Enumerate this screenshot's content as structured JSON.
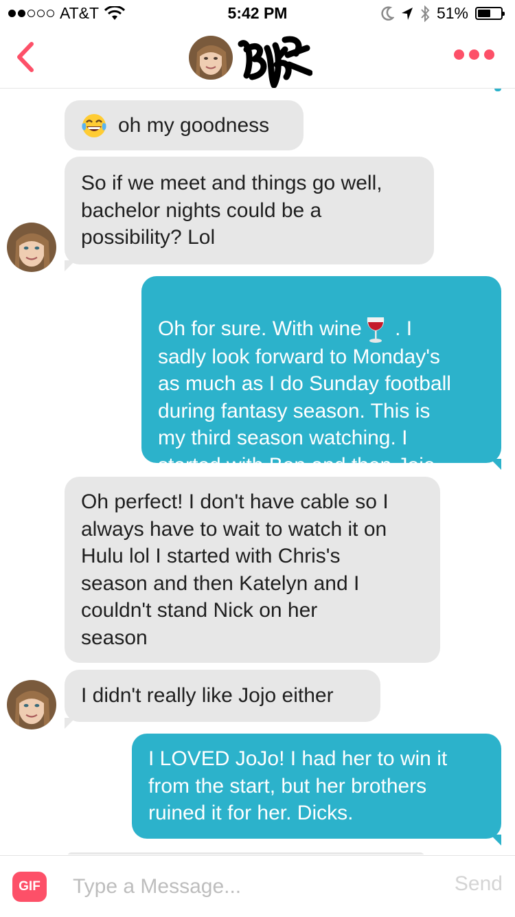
{
  "status_bar": {
    "carrier": "AT&T",
    "time": "5:42 PM",
    "battery": "51%",
    "signal_bars_filled": 2,
    "signal_bars_total": 5,
    "battery_level": 0.51
  },
  "nav": {
    "back_icon": "chevron-left-icon",
    "more_icon": "more-dots-icon",
    "accent_color": "#fd5068"
  },
  "messages": [
    {
      "from": "them",
      "emoji": "tears-of-joy",
      "text": "oh my goodness"
    },
    {
      "from": "them",
      "text": "So if we meet and things go well,\nbachelor nights could be a\npossibility? Lol"
    },
    {
      "from": "me",
      "text_before_emoji": "Oh for sure.  With wine",
      "emoji": "wine-glass",
      "text_after_emoji": " .  I\nsadly look forward to Monday's\nas much as I do Sunday football\nduring fantasy season.  This is\nmy third season watching.  I\nstarted with Ben and then Jojo."
    },
    {
      "from": "them",
      "text": "Oh perfect! I don't have cable so I\nalways have to wait to watch it on\nHulu lol I started with Chris's\nseason and then Katelyn and I\ncouldn't stand Nick on her\nseason"
    },
    {
      "from": "them",
      "text": "I didn't really like Jojo either"
    },
    {
      "from": "me",
      "text": "I LOVED JoJo!  I had her to win it\nfrom the start, but her brothers\nruined it for her.  Dicks."
    }
  ],
  "colors": {
    "incoming_bubble": "#e7e7e7",
    "outgoing_bubble": "#2cb2cb"
  },
  "composer": {
    "gif_label": "GIF",
    "placeholder": "Type a Message...",
    "send_label": "Send"
  }
}
